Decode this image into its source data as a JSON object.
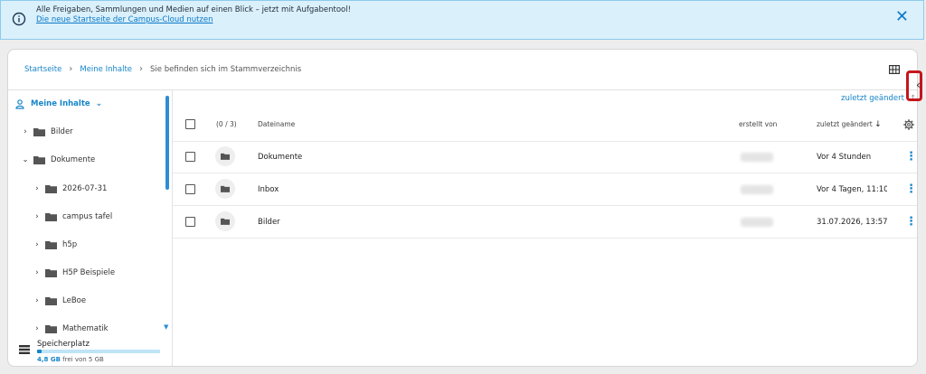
{
  "banner": {
    "message": "Alle Freigaben, Sammlungen und Medien auf einen Blick – jetzt mit Aufgabentool!",
    "link": "Die neue Startseite der Campus-Cloud nutzen",
    "close_label": "✕"
  },
  "breadcrumb": {
    "home": "Startseite",
    "my_content": "Meine Inhalte",
    "current": "Sie befinden sich im Stammverzeichnis"
  },
  "sort": {
    "label": "zuletzt geändert"
  },
  "sidebar": {
    "root_label": "Meine Inhalte",
    "items": [
      {
        "label": "Bilder"
      },
      {
        "label": "Dokumente"
      },
      {
        "label": "2026-07-31"
      },
      {
        "label": "campus tafel"
      },
      {
        "label": "h5p"
      },
      {
        "label": "H5P Beispiele"
      },
      {
        "label": "LeBoe"
      },
      {
        "label": "Mathematik"
      }
    ],
    "storage": {
      "title": "Speicherplatz",
      "free_value": "4,8 GB",
      "rest": "frei von 5 GB",
      "used_fraction": 0.04
    }
  },
  "table": {
    "selection_count": "(0 / 3)",
    "columns": {
      "name": "Dateiname",
      "creator": "erstellt von",
      "modified": "zuletzt geändert"
    },
    "rows": [
      {
        "name": "Dokumente",
        "modified": "Vor 4 Stunden"
      },
      {
        "name": "Inbox",
        "modified": "Vor 4 Tagen, 11:10"
      },
      {
        "name": "Bilder",
        "modified": "31.07.2026, 13:57"
      }
    ]
  },
  "colors": {
    "accent": "#1785c9",
    "banner_bg": "#daf0fb",
    "highlight_border": "#c4161c"
  },
  "icons": {
    "info": "info-icon",
    "close": "close-icon",
    "grid": "grid-view-icon",
    "user": "user-icon",
    "folder": "folder-icon",
    "settings": "gear-icon",
    "storage": "database-icon",
    "more": "kebab-menu-icon"
  }
}
